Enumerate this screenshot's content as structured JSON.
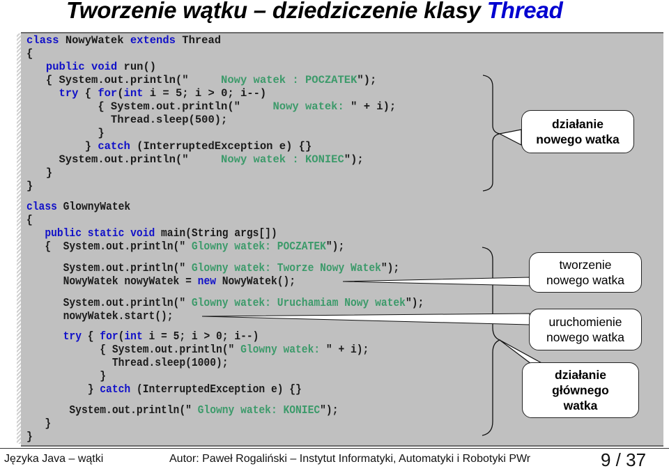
{
  "title": {
    "text": "Tworzenie wątku – dziedziczenie klasy ",
    "accent": "Thread",
    "accent_color": "#0000d0"
  },
  "colors": {
    "keyword": "#1010c8",
    "string": "#3c9a6a",
    "panel": "#c0c0c0"
  },
  "code_block_1": [
    [
      [
        "kw",
        "class"
      ],
      [
        "t",
        " NowyWatek "
      ],
      [
        "kw",
        "extends"
      ],
      [
        "t",
        " Thread"
      ]
    ],
    [
      [
        "t",
        "{"
      ]
    ],
    [
      [
        "t",
        "   "
      ],
      [
        "kw",
        "public void"
      ],
      [
        "t",
        " run()"
      ]
    ],
    [
      [
        "t",
        "   { System.out.println(\""
      ],
      [
        "str",
        "     Nowy watek : POCZATEK"
      ],
      [
        "t",
        "\");"
      ]
    ],
    [
      [
        "t",
        "     "
      ],
      [
        "kw",
        "try"
      ],
      [
        "t",
        " { "
      ],
      [
        "kw",
        "for"
      ],
      [
        "t",
        "("
      ],
      [
        "kw",
        "int"
      ],
      [
        "t",
        " i = 5; i > 0; i--)"
      ]
    ],
    [
      [
        "t",
        "           { System.out.println(\""
      ],
      [
        "str",
        "     Nowy watek: "
      ],
      [
        "t",
        "\" + i);"
      ]
    ],
    [
      [
        "t",
        "             Thread.sleep(500);"
      ]
    ],
    [
      [
        "t",
        "           }"
      ]
    ],
    [
      [
        "t",
        "         } "
      ],
      [
        "kw",
        "catch"
      ],
      [
        "t",
        " (InterruptedException e) {}"
      ]
    ],
    [
      [
        "t",
        "     System.out.println(\""
      ],
      [
        "str",
        "     Nowy watek : KONIEC"
      ],
      [
        "t",
        "\");"
      ]
    ],
    [
      [
        "t",
        "   }"
      ]
    ],
    [
      [
        "t",
        "}"
      ]
    ]
  ],
  "code_block_2": [
    [
      [
        "kw",
        "class"
      ],
      [
        "t",
        " GlownyWatek"
      ]
    ],
    [
      [
        "t",
        "{"
      ]
    ],
    [
      [
        "t",
        "   "
      ],
      [
        "kw",
        "public static void"
      ],
      [
        "t",
        " main(String args[])"
      ]
    ],
    [
      [
        "t",
        "   {  System.out.println(\""
      ],
      [
        "str",
        " Glowny watek: POCZATEK"
      ],
      [
        "t",
        "\");"
      ]
    ]
  ],
  "code_block_3": [
    [
      [
        "t",
        "      System.out.println(\""
      ],
      [
        "str",
        " Glowny watek: Tworze Nowy Watek"
      ],
      [
        "t",
        "\");"
      ]
    ],
    [
      [
        "t",
        "      NowyWatek nowyWatek = "
      ],
      [
        "kw",
        "new"
      ],
      [
        "t",
        " NowyWatek();"
      ]
    ]
  ],
  "code_block_4": [
    [
      [
        "t",
        "      System.out.println(\""
      ],
      [
        "str",
        " Glowny watek: Uruchamiam Nowy watek"
      ],
      [
        "t",
        "\");"
      ]
    ],
    [
      [
        "t",
        "      nowyWatek.start();"
      ]
    ]
  ],
  "code_block_5": [
    [
      [
        "t",
        "      "
      ],
      [
        "kw",
        "try"
      ],
      [
        "t",
        " { "
      ],
      [
        "kw",
        "for"
      ],
      [
        "t",
        "("
      ],
      [
        "kw",
        "int"
      ],
      [
        "t",
        " i = 5; i > 0; i--)"
      ]
    ],
    [
      [
        "t",
        "            { System.out.println(\""
      ],
      [
        "str",
        " Glowny watek: "
      ],
      [
        "t",
        "\" + i);"
      ]
    ],
    [
      [
        "t",
        "              Thread.sleep(1000);"
      ]
    ],
    [
      [
        "t",
        "            }"
      ]
    ],
    [
      [
        "t",
        "          } "
      ],
      [
        "kw",
        "catch"
      ],
      [
        "t",
        " (InterruptedException e) {}"
      ]
    ]
  ],
  "code_block_6": [
    [
      [
        "t",
        "       System.out.println(\""
      ],
      [
        "str",
        " Glowny watek: KONIEC"
      ],
      [
        "t",
        "\");"
      ]
    ],
    [
      [
        "t",
        "   }"
      ]
    ],
    [
      [
        "t",
        "}"
      ]
    ]
  ],
  "callouts": {
    "new_thread_run": {
      "line1": "działanie",
      "line2": "nowego watka"
    },
    "create_thread": {
      "line1": "tworzenie",
      "line2": "nowego watka"
    },
    "start_thread": {
      "line1": "uruchomienie",
      "line2": "nowego watka"
    },
    "main_thread_run": {
      "line1": "działanie",
      "line2": "głównego",
      "line3": "watka"
    }
  },
  "footer": {
    "left": "Języka Java – wątki",
    "center": "Autor: Paweł Rogaliński – Instytut Informatyki, Automatyki i Robotyki PWr",
    "page": "9 / 37"
  }
}
